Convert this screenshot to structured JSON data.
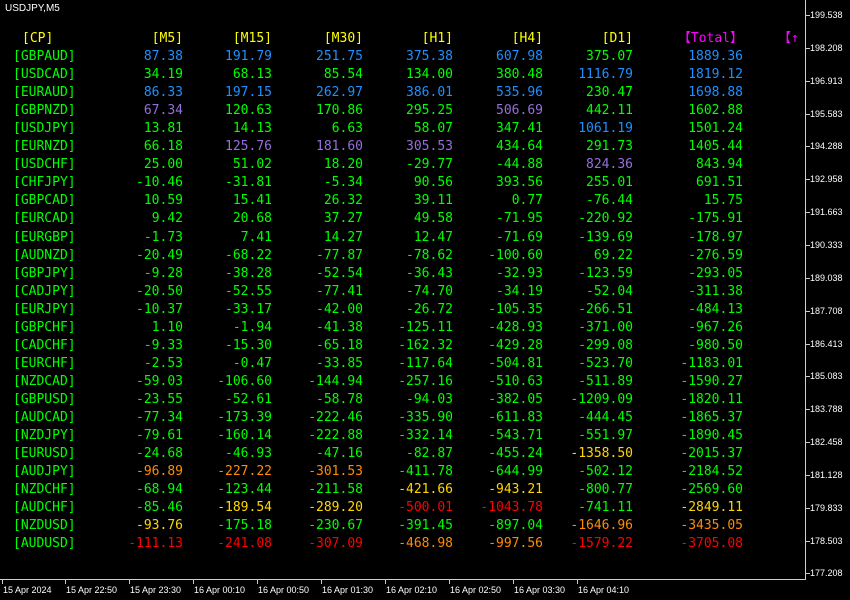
{
  "window": {
    "title": "USDJPY,M5"
  },
  "table": {
    "headers": [
      "[CP]",
      "[M5]",
      "[M15]",
      "[M30]",
      "[H1]",
      "[H4]",
      "[D1]",
      "【Total】",
      "【↑"
    ],
    "header_colors": [
      "#ffff00",
      "#ffff00",
      "#ffff00",
      "#ffff00",
      "#ffff00",
      "#ffff00",
      "#ffff00",
      "#ff00ff",
      "#ff00ff"
    ],
    "rows": [
      {
        "pair": "[GBPAUD]",
        "values": [
          "87.38",
          "191.79",
          "251.75",
          "375.38",
          "607.98",
          "375.07",
          "1889.36"
        ],
        "colors": [
          "#1e90ff",
          "#1e90ff",
          "#1e90ff",
          "#1e90ff",
          "#1e90ff",
          "#00ff00",
          "#1e90ff"
        ]
      },
      {
        "pair": "[USDCAD]",
        "values": [
          "34.19",
          "68.13",
          "85.54",
          "134.00",
          "380.48",
          "1116.79",
          "1819.12"
        ],
        "colors": [
          "#00ff00",
          "#00ff00",
          "#00ff00",
          "#00ff00",
          "#00ff00",
          "#1e90ff",
          "#1e90ff"
        ]
      },
      {
        "pair": "[EURAUD]",
        "values": [
          "86.33",
          "197.15",
          "262.97",
          "386.01",
          "535.96",
          "230.47",
          "1698.88"
        ],
        "colors": [
          "#1e90ff",
          "#1e90ff",
          "#1e90ff",
          "#1e90ff",
          "#1e90ff",
          "#00ff00",
          "#1e90ff"
        ]
      },
      {
        "pair": "[GBPNZD]",
        "values": [
          "67.34",
          "120.63",
          "170.86",
          "295.25",
          "506.69",
          "442.11",
          "1602.88"
        ],
        "colors": [
          "#9370db",
          "#00ff00",
          "#00ff00",
          "#00ff00",
          "#9370db",
          "#00ff00",
          "#00ff00"
        ]
      },
      {
        "pair": "[USDJPY]",
        "values": [
          "13.81",
          "14.13",
          "6.63",
          "58.07",
          "347.41",
          "1061.19",
          "1501.24"
        ],
        "colors": [
          "#00ff00",
          "#00ff00",
          "#00ff00",
          "#00ff00",
          "#00ff00",
          "#1e90ff",
          "#00ff00"
        ]
      },
      {
        "pair": "[EURNZD]",
        "values": [
          "66.18",
          "125.76",
          "181.60",
          "305.53",
          "434.64",
          "291.73",
          "1405.44"
        ],
        "colors": [
          "#00ff00",
          "#9370db",
          "#9370db",
          "#9370db",
          "#00ff00",
          "#00ff00",
          "#00ff00"
        ]
      },
      {
        "pair": "[USDCHF]",
        "values": [
          "25.00",
          "51.02",
          "18.20",
          "-29.77",
          "-44.88",
          "824.36",
          "843.94"
        ],
        "colors": [
          "#00ff00",
          "#00ff00",
          "#00ff00",
          "#00ff00",
          "#00ff00",
          "#9370db",
          "#00ff00"
        ]
      },
      {
        "pair": "[CHFJPY]",
        "values": [
          "-10.46",
          "-31.81",
          "-5.34",
          "90.56",
          "393.56",
          "255.01",
          "691.51"
        ],
        "colors": [
          "#00ff00",
          "#00ff00",
          "#00ff00",
          "#00ff00",
          "#00ff00",
          "#00ff00",
          "#00ff00"
        ]
      },
      {
        "pair": "[GBPCAD]",
        "values": [
          "10.59",
          "15.41",
          "26.32",
          "39.11",
          "0.77",
          "-76.44",
          "15.75"
        ],
        "colors": [
          "#00ff00",
          "#00ff00",
          "#00ff00",
          "#00ff00",
          "#00ff00",
          "#00ff00",
          "#00ff00"
        ]
      },
      {
        "pair": "[EURCAD]",
        "values": [
          "9.42",
          "20.68",
          "37.27",
          "49.58",
          "-71.95",
          "-220.92",
          "-175.91"
        ],
        "colors": [
          "#00ff00",
          "#00ff00",
          "#00ff00",
          "#00ff00",
          "#00ff00",
          "#00ff00",
          "#00ff00"
        ]
      },
      {
        "pair": "[EURGBP]",
        "values": [
          "-1.73",
          "7.41",
          "14.27",
          "12.47",
          "-71.69",
          "-139.69",
          "-178.97"
        ],
        "colors": [
          "#00ff00",
          "#00ff00",
          "#00ff00",
          "#00ff00",
          "#00ff00",
          "#00ff00",
          "#00ff00"
        ]
      },
      {
        "pair": "[AUDNZD]",
        "values": [
          "-20.49",
          "-68.22",
          "-77.87",
          "-78.62",
          "-100.60",
          "69.22",
          "-276.59"
        ],
        "colors": [
          "#00ff00",
          "#00ff00",
          "#00ff00",
          "#00ff00",
          "#00ff00",
          "#00ff00",
          "#00ff00"
        ]
      },
      {
        "pair": "[GBPJPY]",
        "values": [
          "-9.28",
          "-38.28",
          "-52.54",
          "-36.43",
          "-32.93",
          "-123.59",
          "-293.05"
        ],
        "colors": [
          "#00ff00",
          "#00ff00",
          "#00ff00",
          "#00ff00",
          "#00ff00",
          "#00ff00",
          "#00ff00"
        ]
      },
      {
        "pair": "[CADJPY]",
        "values": [
          "-20.50",
          "-52.55",
          "-77.41",
          "-74.70",
          "-34.19",
          "-52.04",
          "-311.38"
        ],
        "colors": [
          "#00ff00",
          "#00ff00",
          "#00ff00",
          "#00ff00",
          "#00ff00",
          "#00ff00",
          "#00ff00"
        ]
      },
      {
        "pair": "[EURJPY]",
        "values": [
          "-10.37",
          "-33.17",
          "-42.00",
          "-26.72",
          "-105.35",
          "-266.51",
          "-484.13"
        ],
        "colors": [
          "#00ff00",
          "#00ff00",
          "#00ff00",
          "#00ff00",
          "#00ff00",
          "#00ff00",
          "#00ff00"
        ]
      },
      {
        "pair": "[GBPCHF]",
        "values": [
          "1.10",
          "-1.94",
          "-41.38",
          "-125.11",
          "-428.93",
          "-371.00",
          "-967.26"
        ],
        "colors": [
          "#00ff00",
          "#00ff00",
          "#00ff00",
          "#00ff00",
          "#00ff00",
          "#00ff00",
          "#00ff00"
        ]
      },
      {
        "pair": "[CADCHF]",
        "values": [
          "-9.33",
          "-15.30",
          "-65.18",
          "-162.32",
          "-429.28",
          "-299.08",
          "-980.50"
        ],
        "colors": [
          "#00ff00",
          "#00ff00",
          "#00ff00",
          "#00ff00",
          "#00ff00",
          "#00ff00",
          "#00ff00"
        ]
      },
      {
        "pair": "[EURCHF]",
        "values": [
          "-2.53",
          "-0.47",
          "-33.85",
          "-117.64",
          "-504.81",
          "-523.70",
          "-1183.01"
        ],
        "colors": [
          "#00ff00",
          "#00ff00",
          "#00ff00",
          "#00ff00",
          "#00ff00",
          "#00ff00",
          "#00ff00"
        ]
      },
      {
        "pair": "[NZDCAD]",
        "values": [
          "-59.03",
          "-106.60",
          "-144.94",
          "-257.16",
          "-510.63",
          "-511.89",
          "-1590.27"
        ],
        "colors": [
          "#00ff00",
          "#00ff00",
          "#00ff00",
          "#00ff00",
          "#00ff00",
          "#00ff00",
          "#00ff00"
        ]
      },
      {
        "pair": "[GBPUSD]",
        "values": [
          "-23.55",
          "-52.61",
          "-58.78",
          "-94.03",
          "-382.05",
          "-1209.09",
          "-1820.11"
        ],
        "colors": [
          "#00ff00",
          "#00ff00",
          "#00ff00",
          "#00ff00",
          "#00ff00",
          "#00ff00",
          "#00ff00"
        ]
      },
      {
        "pair": "[AUDCAD]",
        "values": [
          "-77.34",
          "-173.39",
          "-222.46",
          "-335.90",
          "-611.83",
          "-444.45",
          "-1865.37"
        ],
        "colors": [
          "#00ff00",
          "#00ff00",
          "#00ff00",
          "#00ff00",
          "#00ff00",
          "#00ff00",
          "#00ff00"
        ]
      },
      {
        "pair": "[NZDJPY]",
        "values": [
          "-79.61",
          "-160.14",
          "-222.88",
          "-332.14",
          "-543.71",
          "-551.97",
          "-1890.45"
        ],
        "colors": [
          "#00ff00",
          "#00ff00",
          "#00ff00",
          "#00ff00",
          "#00ff00",
          "#00ff00",
          "#00ff00"
        ]
      },
      {
        "pair": "[EURUSD]",
        "values": [
          "-24.68",
          "-46.93",
          "-47.16",
          "-82.87",
          "-455.24",
          "-1358.50",
          "-2015.37"
        ],
        "colors": [
          "#00ff00",
          "#00ff00",
          "#00ff00",
          "#00ff00",
          "#00ff00",
          "#ffd700",
          "#00ff00"
        ]
      },
      {
        "pair": "[AUDJPY]",
        "values": [
          "-96.89",
          "-227.22",
          "-301.53",
          "-411.78",
          "-644.99",
          "-502.12",
          "-2184.52"
        ],
        "colors": [
          "#ff8c00",
          "#ff8c00",
          "#ff8c00",
          "#00ff00",
          "#00ff00",
          "#00ff00",
          "#00ff00"
        ]
      },
      {
        "pair": "[NZDCHF]",
        "values": [
          "-68.94",
          "-123.44",
          "-211.58",
          "-421.66",
          "-943.21",
          "-800.77",
          "-2569.60"
        ],
        "colors": [
          "#00ff00",
          "#00ff00",
          "#00ff00",
          "#ffd700",
          "#ffd700",
          "#00ff00",
          "#00ff00"
        ]
      },
      {
        "pair": "[AUDCHF]",
        "values": [
          "-85.46",
          "-189.54",
          "-289.20",
          "-500.01",
          "-1043.78",
          "-741.11",
          "-2849.11"
        ],
        "colors": [
          "#00ff00",
          "#ffd700",
          "#ffd700",
          "#ff0000",
          "#ff0000",
          "#00ff00",
          "#ffd700"
        ]
      },
      {
        "pair": "[NZDUSD]",
        "values": [
          "-93.76",
          "-175.18",
          "-230.67",
          "-391.45",
          "-897.04",
          "-1646.96",
          "-3435.05"
        ],
        "colors": [
          "#ffd700",
          "#00ff00",
          "#00ff00",
          "#00ff00",
          "#00ff00",
          "#ff8c00",
          "#ff8c00"
        ]
      },
      {
        "pair": "[AUDUSD]",
        "values": [
          "-111.13",
          "-241.08",
          "-307.09",
          "-468.98",
          "-997.56",
          "-1579.22",
          "-3705.08"
        ],
        "colors": [
          "#ff0000",
          "#ff0000",
          "#ff0000",
          "#ff8c00",
          "#ff8c00",
          "#ff0000",
          "#ff0000"
        ]
      }
    ],
    "pair_color": "#00ff00"
  },
  "price_axis": [
    "199.538",
    "198.208",
    "196.913",
    "195.583",
    "194.288",
    "192.958",
    "191.663",
    "190.333",
    "189.038",
    "187.708",
    "186.413",
    "185.083",
    "183.788",
    "182.458",
    "181.128",
    "179.833",
    "178.503",
    "177.208"
  ],
  "time_axis": [
    "15 Apr 2024",
    "15 Apr 22:50",
    "15 Apr 23:30",
    "16 Apr 00:10",
    "16 Apr 00:50",
    "16 Apr 01:30",
    "16 Apr 02:10",
    "16 Apr 02:50",
    "16 Apr 03:30",
    "16 Apr 04:10"
  ]
}
